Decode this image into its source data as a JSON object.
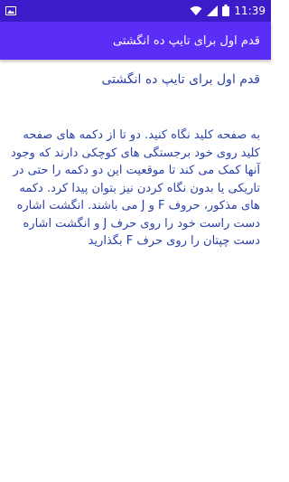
{
  "status_bar": {
    "time": "11:39",
    "icons": [
      "image-icon",
      "wifi-icon",
      "signal-icon",
      "battery-icon"
    ]
  },
  "app_bar": {
    "title": "قدم اول برای تایپ ده انگشتی"
  },
  "main": {
    "heading": "قدم اول برای تایپ ده انگشتی",
    "body": "به صفحه کلید نگاه کنید. دو تا از دکمه های صفحه کلید روی خود برجستگی های کوچکی دارند که وجود آنها کمک می کند تا موقعیت این دو دکمه را حتی در تاریکی یا بدون نگاه کردن نیز بتوان پیدا کرد. دکمه های مذکور، حروف F و J می باشند. انگشت اشاره دست راست خود را روی حرف J و انگشت اشاره دست چپتان را روی حرف F بگذارید"
  },
  "colors": {
    "status_bar": "#3e1bc9",
    "app_bar": "#5a2ef7",
    "text": "#2a3fa8"
  }
}
